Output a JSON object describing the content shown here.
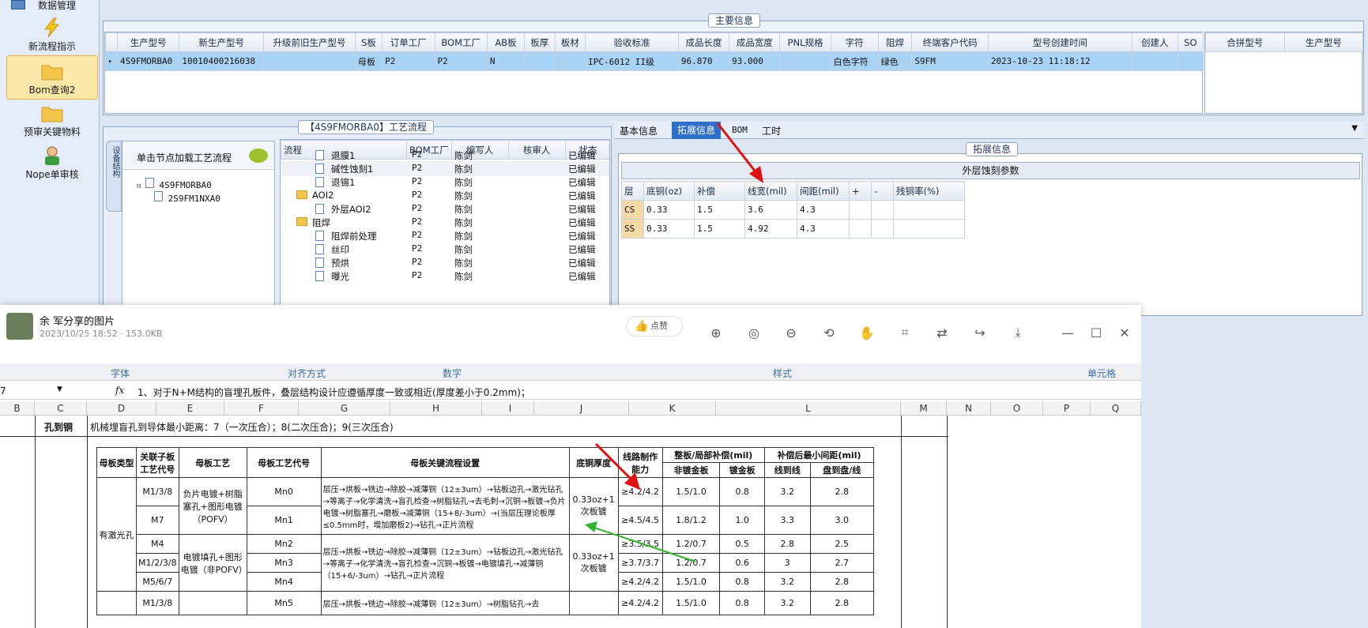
{
  "sidebar": {
    "items": [
      {
        "label": "数据管理"
      },
      {
        "label": "新流程指示"
      },
      {
        "label": "Bom查询2"
      },
      {
        "label": "预审关键物料"
      },
      {
        "label": "Nope单审核"
      }
    ]
  },
  "main_info": {
    "title": "主要信息",
    "columns": [
      "生产型号",
      "新生产型号",
      "升级前旧生产型号",
      "S板",
      "订单工厂",
      "BOM工厂",
      "AB板",
      "板厚",
      "板材",
      "验收标准",
      "成品长度",
      "成品宽度",
      "PNL规格",
      "字符",
      "阻焊",
      "终端客户代码",
      "型号创建时间",
      "创建人",
      "SO"
    ],
    "row": [
      "4S9FMORBA0",
      "10010400216038",
      "",
      "母板",
      "P2",
      "P2",
      "N",
      "",
      "",
      "IPC-6012 II级",
      "96.870",
      "93.000",
      "",
      "白色字符",
      "绿色",
      "S9FM",
      "2023-10-23 11:18:12",
      "",
      ""
    ],
    "side_columns": [
      "合拼型号",
      "生产型号"
    ]
  },
  "process": {
    "title": "【4S9FMORBA0】工艺流程",
    "vtab": "设备结构",
    "hint": "单击节点加载工艺流程",
    "tree": [
      "4S9FMORBA0",
      "2S9FM1NXA0"
    ],
    "columns": [
      "流程",
      "BOM工厂",
      "编写人",
      "核审人",
      "状态"
    ],
    "rows": [
      {
        "name": "退膜1",
        "factory": "P2",
        "author": "陈剑",
        "reviewer": "",
        "status": "已编辑",
        "kind": "doc",
        "level": 2
      },
      {
        "name": "碱性蚀刻1",
        "factory": "P2",
        "author": "陈剑",
        "reviewer": "",
        "status": "已编辑",
        "kind": "doc",
        "level": 2
      },
      {
        "name": "退锡1",
        "factory": "P2",
        "author": "陈剑",
        "reviewer": "",
        "status": "已编辑",
        "kind": "doc",
        "level": 2
      },
      {
        "name": "AOI2",
        "factory": "P2",
        "author": "陈剑",
        "reviewer": "",
        "status": "已编辑",
        "kind": "folder",
        "level": 1
      },
      {
        "name": "外层AOI2",
        "factory": "P2",
        "author": "陈剑",
        "reviewer": "",
        "status": "已编辑",
        "kind": "doc",
        "level": 2
      },
      {
        "name": "阻焊",
        "factory": "P2",
        "author": "陈剑",
        "reviewer": "",
        "status": "已编辑",
        "kind": "folder",
        "level": 1
      },
      {
        "name": "阻焊前处理",
        "factory": "P2",
        "author": "陈剑",
        "reviewer": "",
        "status": "已编辑",
        "kind": "doc",
        "level": 2
      },
      {
        "name": "丝印",
        "factory": "P2",
        "author": "陈剑",
        "reviewer": "",
        "status": "已编辑",
        "kind": "doc",
        "level": 2
      },
      {
        "name": "预烘",
        "factory": "P2",
        "author": "陈剑",
        "reviewer": "",
        "status": "已编辑",
        "kind": "doc",
        "level": 2
      },
      {
        "name": "曝光",
        "factory": "P2",
        "author": "陈剑",
        "reviewer": "",
        "status": "已编辑",
        "kind": "doc",
        "level": 2
      }
    ]
  },
  "tabs": [
    "基本信息",
    "拓展信息",
    "BOM",
    "工时"
  ],
  "ext": {
    "legend": "拓展信息",
    "caption": "外层蚀刻参数",
    "columns": [
      "层",
      "底铜(oz)",
      "补偿",
      "线宽(mil)",
      "间距(mil)",
      "+",
      "-",
      "残铜率(%)"
    ],
    "rows": [
      [
        "CS",
        "0.33",
        "1.5",
        "3.6",
        "4.3",
        "",
        "",
        ""
      ],
      [
        "SS",
        "0.33",
        "1.5",
        "4.92",
        "4.3",
        "",
        "",
        ""
      ]
    ]
  },
  "viewer": {
    "title": "余 军分享的图片",
    "meta": "2023/10/25 18:52 · 153.0KB",
    "like": "点赞"
  },
  "excel": {
    "ribbon": [
      "字体",
      "对齐方式",
      "数字",
      "样式",
      "单元格"
    ],
    "cellref": "7",
    "formula": "1、对于N+M结构的盲埋孔板件，叠层结构设计应遵循厚度一致或相近(厚度差小于0.2mm)；",
    "cols": [
      "B",
      "C",
      "D",
      "E",
      "F",
      "G",
      "H",
      "I",
      "J",
      "K",
      "L",
      "M",
      "N",
      "O",
      "P",
      "Q"
    ],
    "row_label": "孔到铜",
    "row_text": "机械埋盲孔到导体最小距离：7（一次压合）；8(二次压合)；9(三次压合)",
    "table": {
      "h1": [
        "母板类型",
        "关联子板工艺代号",
        "母板工艺",
        "母板工艺代号",
        "母板关键流程设置",
        "底铜厚度",
        "线路制作能力",
        "整板/局部补偿(mil)",
        "补偿后最小间距(mil)"
      ],
      "h2": [
        "非镀金板",
        "镀金板",
        "线到线",
        "盘到盘/线"
      ],
      "type": "有激光孔",
      "proc1": "负片电镀+树脂塞孔+图形电镀（POFV）",
      "proc2": "电镀填孔+图形电镀（非POFV）",
      "flow1": "层压→烘板→铣边→除胶→减薄铜（12±3um）→钻板边孔→激光钻孔→等离子→化学清洗→盲孔检查→树脂钻孔→去毛刺→沉铜→板镀→负片电镀→树脂塞孔→磨板→减薄铜（15+8/-3um）→(当层压理论板厚≤0.5mm时，增加磨板2)→钻孔→正片流程",
      "flow2": "层压→烘板→铣边→除胶→减薄铜（12±3um）→钻板边孔→激光钻孔→等离子→化学清洗→盲孔检查→沉铜→板镀→电镀填孔→减薄铜（15+6/-3um）→钻孔→正片流程",
      "flow3": "层压→烘板→铣边→除胶→减薄铜（12±3um）→树脂钻孔→去",
      "cu": "0.33oz+1次板镀",
      "rows": [
        [
          "M1/3/8",
          "Mn0",
          "≥4.2/4.2",
          "1.5/1.0",
          "0.8",
          "3.2",
          "2.8"
        ],
        [
          "M7",
          "Mn1",
          "≥4.5/4.5",
          "1.8/1.2",
          "1.0",
          "3.3",
          "3.0"
        ],
        [
          "M4",
          "Mn2",
          "≥3.5/3.5",
          "1.2/0.7",
          "0.5",
          "2.8",
          "2.5"
        ],
        [
          "M1/2/3/8",
          "Mn3",
          "≥3.7/3.7",
          "1.2/0.7",
          "0.6",
          "3",
          "2.7"
        ],
        [
          "M5/6/7",
          "Mn4",
          "≥4.2/4.2",
          "1.5/1.0",
          "0.8",
          "3.2",
          "2.8"
        ],
        [
          "M1/3/8",
          "Mn5",
          "≥4.2/4.2",
          "1.5/1.0",
          "0.8",
          "3.2",
          "2.8"
        ]
      ]
    }
  },
  "colors": {
    "selected_row": "#a9d3f5",
    "tab_active": "#2f6fc9",
    "arrow_red": "#e01010",
    "arrow_green": "#2fb52f"
  }
}
